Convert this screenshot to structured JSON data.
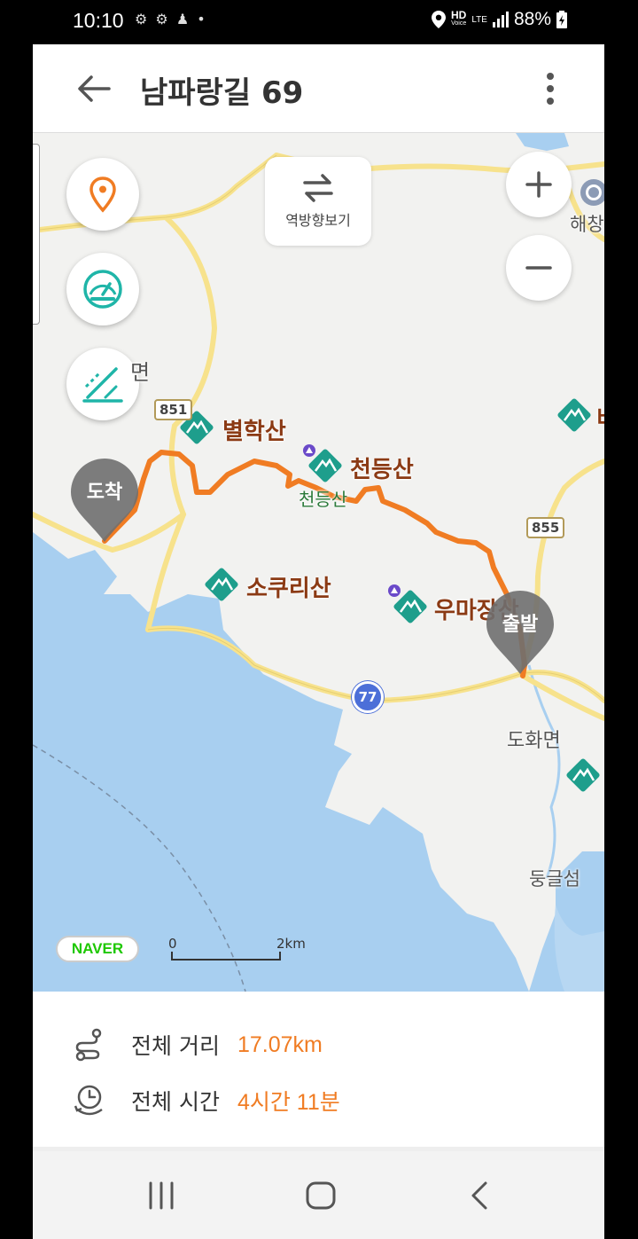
{
  "status_bar": {
    "time": "10:10",
    "battery": "88%",
    "network_hd": "HD",
    "network_voice": "Voice",
    "network_lte": "LTE"
  },
  "header": {
    "title": "남파랑길 69"
  },
  "map": {
    "reverse_label": "역방향보기",
    "zoom_in": "+",
    "zoom_out": "−",
    "places": {
      "byeolhaksan": "별학산",
      "cheondeungsan": "천등산",
      "cheondeungsan_small": "천등산",
      "sokurisan": "소쿠리산",
      "umajangsan": "우마장산",
      "dohwamyeon": "도화면",
      "dunggeulseom": "둥글섬",
      "haechang": "해창",
      "myeon_left": "면",
      "edge_label": "비"
    },
    "road_shields": {
      "r851": "851",
      "r855": "855",
      "r77": "77"
    },
    "pins": {
      "arrival": "도착",
      "start": "출발"
    },
    "logo": "NAVER",
    "scale_start": "0",
    "scale_end": "2km",
    "route_color": "#f07c23"
  },
  "info": {
    "distance_label": "전체 거리",
    "distance_value": "17.07km",
    "time_label": "전체 시간",
    "time_value": "4시간 11분"
  }
}
